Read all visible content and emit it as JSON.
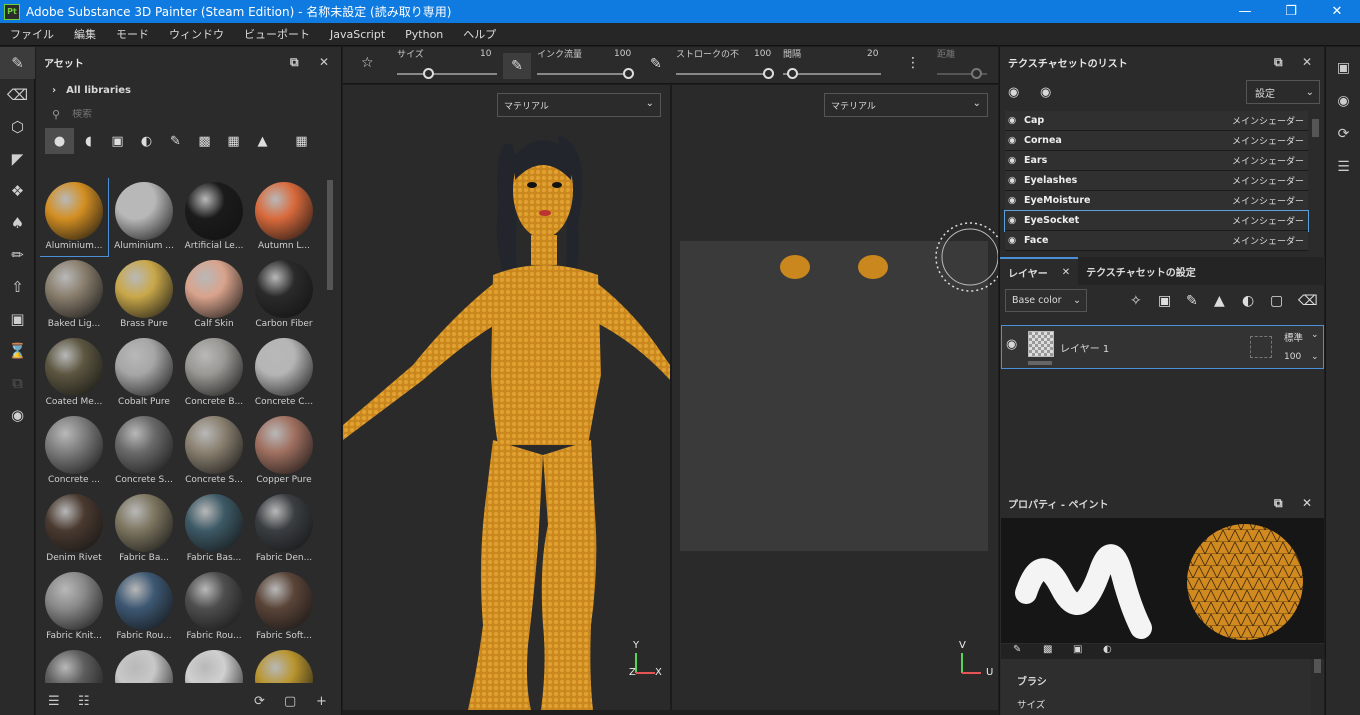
{
  "window": {
    "title": "Adobe Substance 3D Painter (Steam Edition) - 名称未設定 (読み取り専用)",
    "app_icon": "Pt",
    "controls": [
      "minimize-icon",
      "maximize-icon",
      "close-icon"
    ]
  },
  "menu": [
    "ファイル",
    "編集",
    "モード",
    "ウィンドウ",
    "ビューポート",
    "JavaScript",
    "Python",
    "ヘルプ"
  ],
  "tools": [
    "paint-brush-icon",
    "eraser-icon",
    "projection-icon",
    "polygon-fill-icon",
    "smudge-icon",
    "clone-icon",
    "color-picker-icon",
    "export-icon",
    "bake-icon",
    "iray-icon",
    "link-icon",
    "screenshot-icon"
  ],
  "assets": {
    "title": "アセット",
    "library": "All libraries",
    "search_placeholder": "検索",
    "filters": [
      "material-filter",
      "smart-material-filter",
      "mask-filter",
      "filter-filter",
      "brush-filter",
      "alpha-filter",
      "procedural-filter",
      "environment-filter",
      "grid-view"
    ],
    "items": [
      {
        "label": "Aluminium...",
        "color": "#d38f22"
      },
      {
        "label": "Aluminium ...",
        "color": "#b8b8b8"
      },
      {
        "label": "Artificial Le...",
        "color": "#1b1b1b"
      },
      {
        "label": "Autumn L...",
        "color": "#d96a3c"
      },
      {
        "label": "Baked Lig...",
        "color": "#8a7f6e"
      },
      {
        "label": "Brass Pure",
        "color": "#c9a84a"
      },
      {
        "label": "Calf Skin",
        "color": "#d9a38c"
      },
      {
        "label": "Carbon Fiber",
        "color": "#2a2a2a"
      },
      {
        "label": "Coated Me...",
        "color": "#5c5640"
      },
      {
        "label": "Cobalt Pure",
        "color": "#a6a6a6"
      },
      {
        "label": "Concrete B...",
        "color": "#9a9894"
      },
      {
        "label": "Concrete C...",
        "color": "#b5b5b5"
      },
      {
        "label": "Concrete ...",
        "color": "#7e7e7e"
      },
      {
        "label": "Concrete S...",
        "color": "#6a6a6a"
      },
      {
        "label": "Concrete S...",
        "color": "#8a8070"
      },
      {
        "label": "Copper Pure",
        "color": "#a07060"
      },
      {
        "label": "Denim Rivet",
        "color": "#4a3a30"
      },
      {
        "label": "Fabric Ba...",
        "color": "#7d7660"
      },
      {
        "label": "Fabric Bas...",
        "color": "#3d5a66"
      },
      {
        "label": "Fabric Den...",
        "color": "#3a3e42"
      },
      {
        "label": "Fabric Knit...",
        "color": "#8a8a8a"
      },
      {
        "label": "Fabric Rou...",
        "color": "#3d5873"
      },
      {
        "label": "Fabric Rou...",
        "color": "#4e4e4e"
      },
      {
        "label": "Fabric Soft...",
        "color": "#5a4438"
      },
      {
        "label": "",
        "color": "#5e5e5e"
      },
      {
        "label": "",
        "color": "#c8c8c8"
      },
      {
        "label": "",
        "color": "#d0d0d0"
      },
      {
        "label": "",
        "color": "#b8952e"
      }
    ],
    "footer": [
      "import-icon",
      "new-folder-icon",
      "refresh-icon",
      "folder-icon",
      "add-icon"
    ]
  },
  "tool_options": {
    "size_label": "サイズ",
    "size_value": "10",
    "flow_label": "インク流量",
    "flow_value": "100",
    "stroke_label": "ストロークの不",
    "stroke_value": "100",
    "spacing_label": "間隔",
    "spacing_value": "20",
    "distance_label": "距離"
  },
  "viewport": {
    "left_mode": "マテリアル",
    "right_mode": "マテリアル",
    "axis_y": "Y",
    "axis_x": "X",
    "axis_z": "Z",
    "axis_v": "V",
    "axis_u": "U"
  },
  "texture_sets": {
    "title": "テクスチャセットのリスト",
    "settings": "設定",
    "rows": [
      {
        "name": "Cap",
        "shader": "メインシェーダー"
      },
      {
        "name": "Cornea",
        "shader": "メインシェーダー"
      },
      {
        "name": "Ears",
        "shader": "メインシェーダー"
      },
      {
        "name": "Eyelashes",
        "shader": "メインシェーダー"
      },
      {
        "name": "EyeMoisture",
        "shader": "メインシェーダー"
      },
      {
        "name": "EyeSocket",
        "shader": "メインシェーダー"
      },
      {
        "name": "Face",
        "shader": "メインシェーダー"
      }
    ]
  },
  "layers": {
    "tab_layers": "レイヤー",
    "tab_settings": "テクスチャセットの設定",
    "channel": "Base color",
    "layer_name": "レイヤー 1",
    "blend_mode": "標準",
    "opacity": "100"
  },
  "properties": {
    "title": "プロパティ - ペイント",
    "section": "ブラシ",
    "size_label": "サイズ"
  }
}
